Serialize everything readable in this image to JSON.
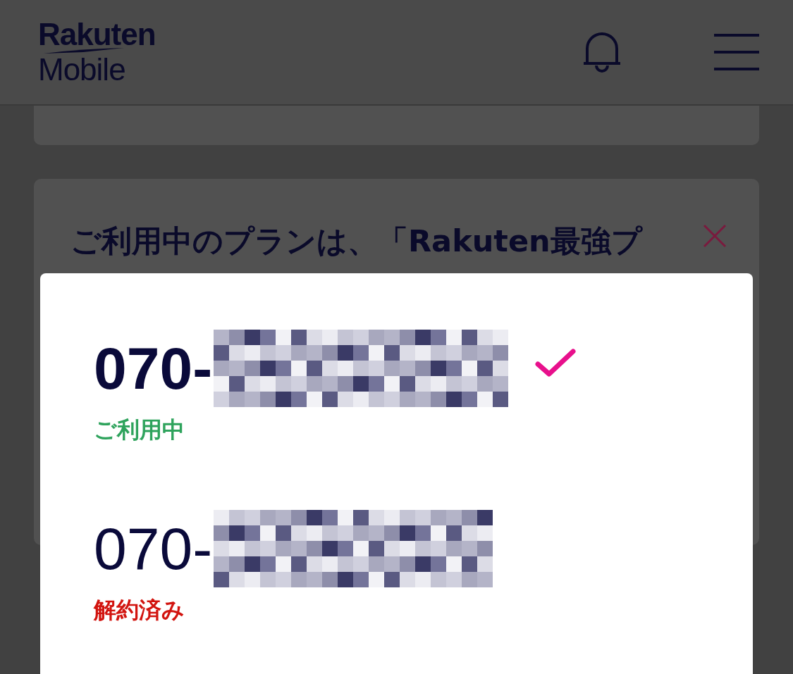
{
  "header": {
    "logo_line_1": "Rakuten",
    "logo_line_2": "Mobile"
  },
  "notice_card": {
    "title": "ご利用中のプランは、「Rakuten最強プ"
  },
  "line_picker": {
    "lines": [
      {
        "number_prefix": "070-",
        "status": "ご利用中",
        "kind": "active",
        "selected": true
      },
      {
        "number_prefix": "070-",
        "status": "解約済み",
        "kind": "cancelled",
        "selected": false
      }
    ]
  }
}
